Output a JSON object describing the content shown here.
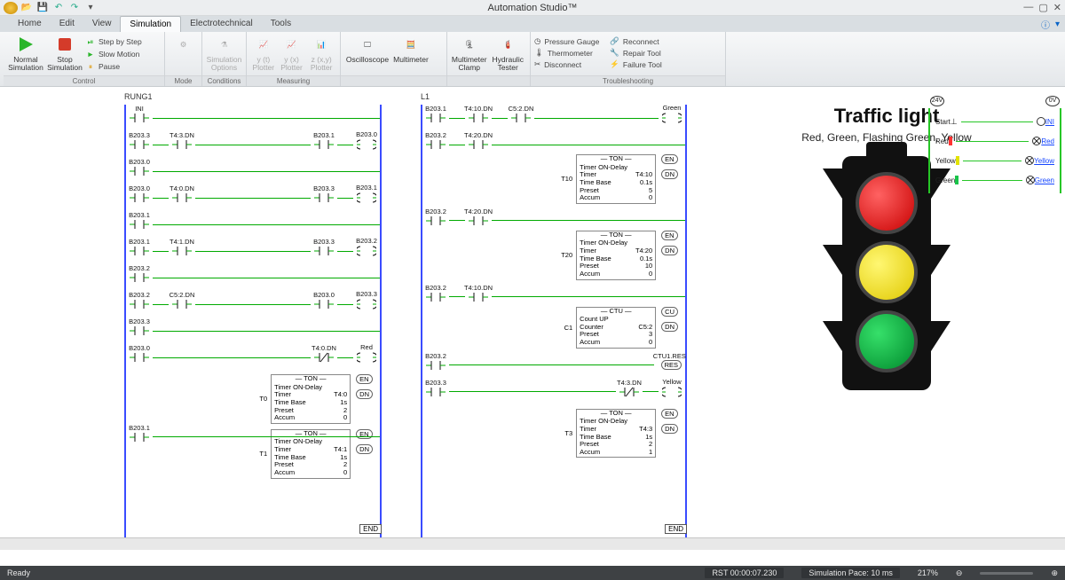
{
  "app": {
    "title": "Automation Studio™"
  },
  "menu": {
    "tabs": [
      "Home",
      "Edit",
      "View",
      "Simulation",
      "Electrotechnical",
      "Tools"
    ],
    "active": "Simulation"
  },
  "ribbon": {
    "groups": {
      "control": {
        "label": "Control",
        "normal_sim": "Normal\nSimulation",
        "stop_sim": "Stop\nSimulation",
        "step": "Step by Step",
        "slow": "Slow Motion",
        "pause": "Pause"
      },
      "mode": {
        "label": "Mode"
      },
      "conditions": {
        "label": "Conditions",
        "sim_opts": "Simulation\nOptions"
      },
      "measuring": {
        "label": "Measuring",
        "yt": "y (t)\nPlotter",
        "yx": "y (x)\nPlotter",
        "zxy": "z (x,y)\nPlotter",
        "osc": "Oscilloscope",
        "mm": "Multimeter",
        "clamp": "Multimeter\nClamp",
        "hyd": "Hydraulic\nTester"
      },
      "trouble": {
        "label": "Troubleshooting",
        "pg": "Pressure Gauge",
        "th": "Thermometer",
        "dc": "Disconnect",
        "rc": "Reconnect",
        "rt": "Repair Tool",
        "ft": "Failure Tool"
      }
    }
  },
  "ladder1": {
    "title": "RUNG1",
    "rungs": [
      {
        "contacts": [
          {
            "l": "INI"
          }
        ]
      },
      {
        "contacts": [
          {
            "l": "B203.3"
          },
          {
            "l": "T4:3.DN"
          }
        ],
        "outputs": [
          {
            "l": "B203.1"
          },
          {
            "l": "B203.0",
            "type": "coil"
          }
        ]
      },
      {
        "contacts": [
          {
            "l": "B203.0"
          }
        ]
      },
      {
        "contacts": [
          {
            "l": "B203.0"
          },
          {
            "l": "T4:0.DN"
          }
        ],
        "outputs": [
          {
            "l": "B203.3"
          },
          {
            "l": "B203.1",
            "type": "coil"
          }
        ]
      },
      {
        "contacts": [
          {
            "l": "B203.1"
          }
        ]
      },
      {
        "contacts": [
          {
            "l": "B203.1"
          },
          {
            "l": "T4:1.DN"
          }
        ],
        "outputs": [
          {
            "l": "B203.3"
          },
          {
            "l": "B203.2",
            "type": "coil"
          }
        ]
      },
      {
        "contacts": [
          {
            "l": "B203.2"
          }
        ]
      },
      {
        "contacts": [
          {
            "l": "B203.2"
          },
          {
            "l": "C5:2.DN"
          }
        ],
        "outputs": [
          {
            "l": "B203.0"
          },
          {
            "l": "B203.3",
            "type": "coil"
          }
        ]
      },
      {
        "contacts": [
          {
            "l": "B203.3"
          }
        ]
      },
      {
        "contacts": [
          {
            "l": "B203.0"
          }
        ],
        "outputs": [
          {
            "seg": true,
            "l": "T4:0.DN"
          },
          {
            "l": "Red",
            "type": "coil"
          }
        ]
      }
    ],
    "instr": [
      {
        "tag": "T0",
        "type": "TON",
        "title": "Timer ON-Delay",
        "rows": [
          [
            "Timer",
            "T4:0"
          ],
          [
            "Time Base",
            "1s"
          ],
          [
            "Preset",
            "2"
          ],
          [
            "Accum",
            "0"
          ]
        ]
      },
      {
        "tag": "T1",
        "type": "TON",
        "title": "Timer ON-Delay",
        "rows": [
          [
            "Timer",
            "T4:1"
          ],
          [
            "Time Base",
            "1s"
          ],
          [
            "Preset",
            "2"
          ],
          [
            "Accum",
            "0"
          ]
        ]
      }
    ],
    "b2031_row": {
      "l": "B203.1"
    },
    "end": "END"
  },
  "ladder2": {
    "title": "L1",
    "rungs": [
      {
        "contacts": [
          {
            "l": "B203.1"
          },
          {
            "l": "T4:10.DN"
          },
          {
            "l": "C5:2.DN"
          }
        ],
        "outputs": [
          {
            "l": "Green",
            "type": "coil"
          }
        ]
      },
      {
        "contacts": [
          {
            "l": "B203.2"
          },
          {
            "l": "T4:20.DN"
          }
        ]
      },
      {
        "contacts": [
          {
            "l": "B203.2"
          },
          {
            "l": "T4:20.DN"
          }
        ]
      },
      {
        "contacts": [
          {
            "l": "B203.2"
          },
          {
            "l": "T4:10.DN"
          }
        ]
      },
      {
        "contacts": [
          {
            "l": "B203.2"
          }
        ]
      },
      {
        "contacts": [
          {
            "l": "B203.3"
          }
        ],
        "outputs": [
          {
            "seg": true,
            "l": "T4:3.DN"
          },
          {
            "l": "Yellow",
            "type": "coil"
          }
        ]
      }
    ],
    "instr": [
      {
        "tag": "T10",
        "type": "TON",
        "title": "Timer ON-Delay",
        "rows": [
          [
            "Timer",
            "T4:10"
          ],
          [
            "Time Base",
            "0.1s"
          ],
          [
            "Preset",
            "5"
          ],
          [
            "Accum",
            "0"
          ]
        ]
      },
      {
        "tag": "T20",
        "type": "TON",
        "title": "Timer ON-Delay",
        "rows": [
          [
            "Timer",
            "T4:20"
          ],
          [
            "Time Base",
            "0.1s"
          ],
          [
            "Preset",
            "10"
          ],
          [
            "Accum",
            "0"
          ]
        ]
      },
      {
        "tag": "C1",
        "type": "CTU",
        "title": "Count UP",
        "rows": [
          [
            "Counter",
            "C5:2"
          ],
          [
            "Preset",
            "3"
          ],
          [
            "Accum",
            "0"
          ]
        ]
      },
      {
        "tag": "T3",
        "type": "TON",
        "title": "Timer ON-Delay",
        "rows": [
          [
            "Timer",
            "T4:3"
          ],
          [
            "Time Base",
            "1s"
          ],
          [
            "Preset",
            "2"
          ],
          [
            "Accum",
            "1"
          ]
        ]
      }
    ],
    "ctu_res": "CTU1.RES",
    "end": "END"
  },
  "right": {
    "title": "Traffic light",
    "subtitle": "Red, Green, Flashing Green, Yellow"
  },
  "wiring": {
    "plus": "24V",
    "minus": "0V",
    "rows": [
      {
        "a": "Start",
        "b": "INI"
      },
      {
        "a": "Red",
        "b": "Red"
      },
      {
        "a": "Yellow",
        "b": "Yellow"
      },
      {
        "a": "Green",
        "b": "Green"
      }
    ]
  },
  "status": {
    "ready": "Ready",
    "rst": "RST 00:00:07.230",
    "pace": "Simulation Pace: 10 ms",
    "zoom": "217%"
  },
  "enable_labels": {
    "en": "EN",
    "dn": "DN",
    "cu": "CU"
  }
}
